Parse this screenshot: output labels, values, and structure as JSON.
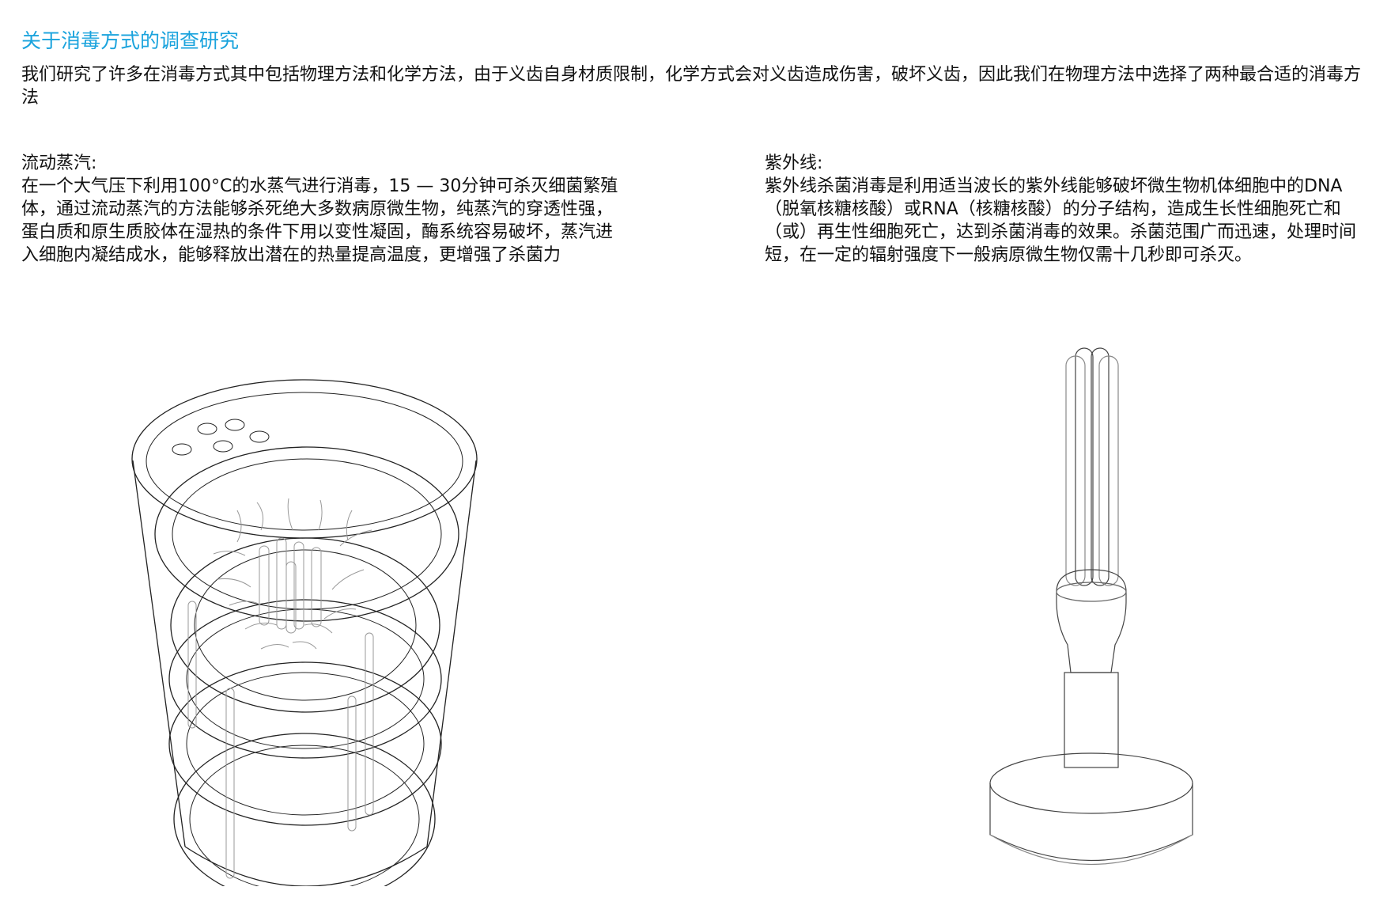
{
  "page": {
    "title": "关于消毒方式的调查研究",
    "intro": "我们研究了许多在消毒方式其中包括物理方法和化学方法，由于义齿自身材质限制，化学方式会对义齿造成伤害，破坏义齿，因此我们在物理方法中选择了两种最合适的消毒方法",
    "accent_color": "#1aa3dd"
  },
  "sections": {
    "steam": {
      "heading": "流动蒸汽:",
      "body": "在一个大气压下利用100°C的水蒸气进行消毒，15 — 30分钟可杀灭细菌繁殖体，通过流动蒸汽的方法能够杀死绝大多数病原微生物，纯蒸汽的穿透性强，蛋白质和原生质胶体在湿热的条件下用以变性凝固，酶系统容易破坏，蒸汽进入细胞内凝结成水，能够释放出潜在的热量提高温度，更增强了杀菌力"
    },
    "uv": {
      "heading": "紫外线:",
      "body": "紫外线杀菌消毒是利用适当波长的紫外线能够破坏微生物机体细胞中的DNA（脱氧核糖核酸）或RNA（核糖核酸）的分子结构，造成生长性细胞死亡和（或）再生性细胞死亡，达到杀菌消毒的效果。杀菌范围广而迅速，处理时间短，在一定的辐射强度下一般病原微生物仅需十几秒即可杀灭。"
    }
  },
  "figures": {
    "steam_device": "steam-cup-line-drawing",
    "uv_lamp": "uv-lamp-line-drawing"
  }
}
